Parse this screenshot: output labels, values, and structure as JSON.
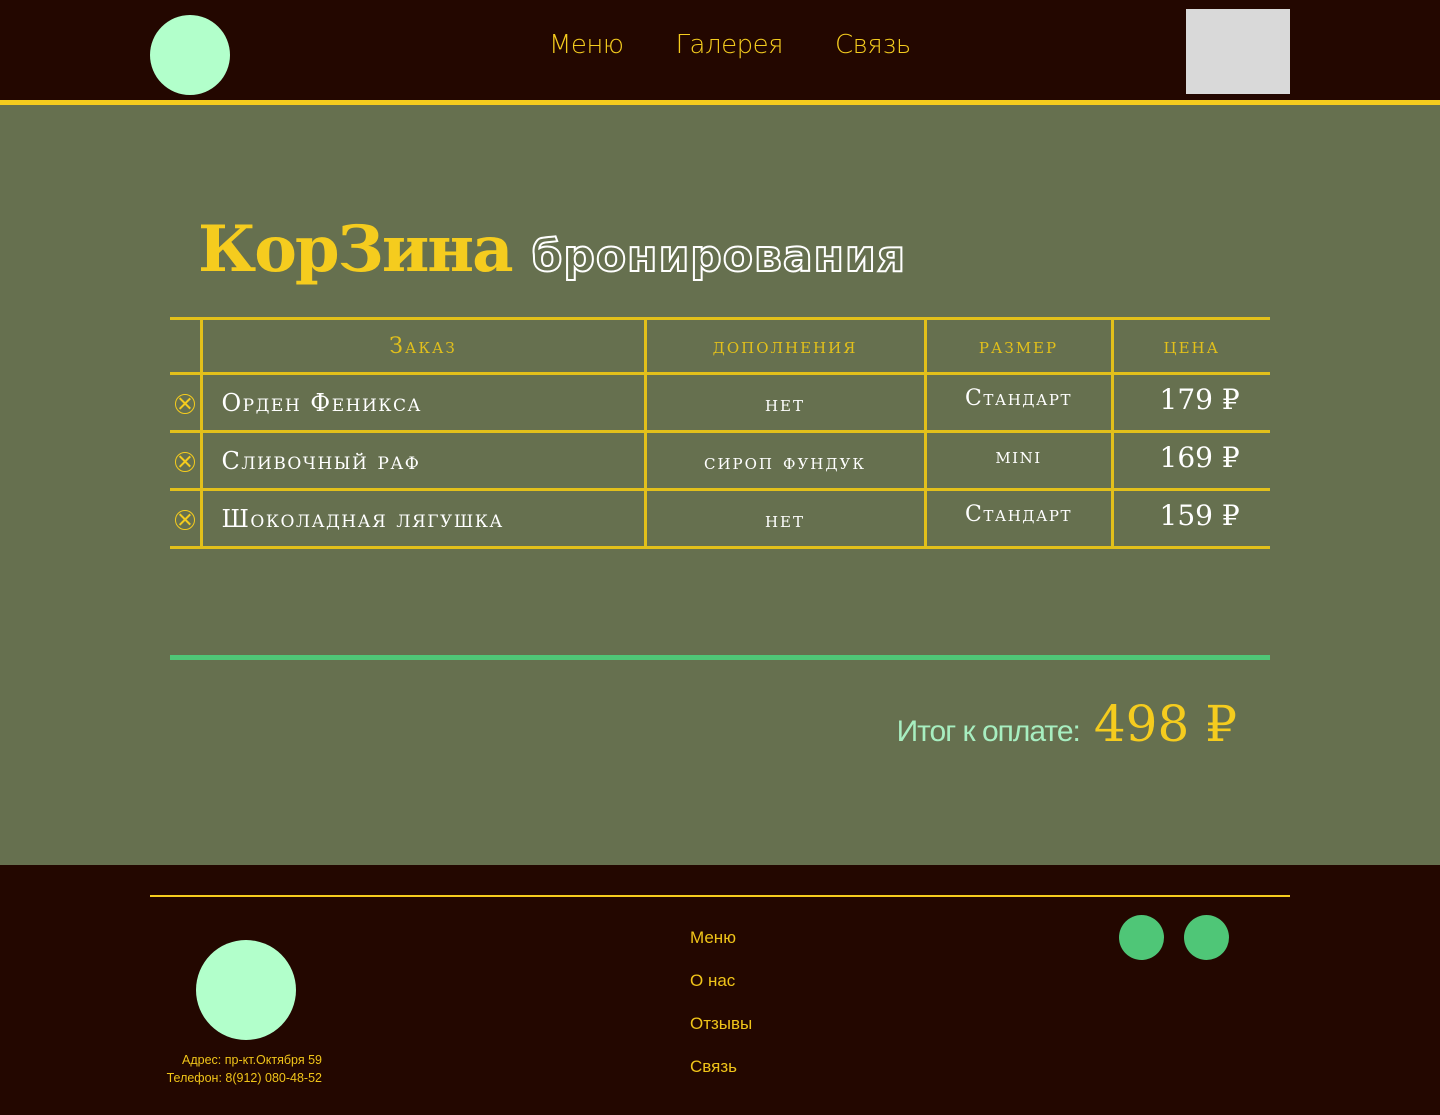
{
  "header": {
    "nav": [
      "Меню",
      "Галерея",
      "Связь"
    ]
  },
  "title": {
    "main": "КорЗина",
    "sub": "бронирования"
  },
  "table": {
    "headers": [
      "Заказ",
      "дополнения",
      "размер",
      "цена"
    ],
    "rows": [
      {
        "name": "Орден Феникса",
        "add": "нет",
        "size": "Стандарт",
        "price": "179 ₽"
      },
      {
        "name": "Сливочный раф",
        "add": "сироп фундук",
        "size": "mini",
        "price": "169 ₽"
      },
      {
        "name": "Шоколадная лягушка",
        "add": "нет",
        "size": "Стандарт",
        "price": "159 ₽"
      }
    ]
  },
  "total": {
    "label": "Итог к оплате:",
    "value": "498 ₽"
  },
  "footer": {
    "address": "Адрес: пр-кт.Октября 59",
    "phone": "Телефон: 8(912) 080-48-52",
    "nav": [
      "Меню",
      "О нас",
      "Отзывы",
      "Связь"
    ]
  },
  "colors": {
    "header_bg": "#230700",
    "accent_yellow": "#f5cc1e",
    "page_bg": "#66704f",
    "mint": "#b2ffcb",
    "green": "#4fc677"
  }
}
